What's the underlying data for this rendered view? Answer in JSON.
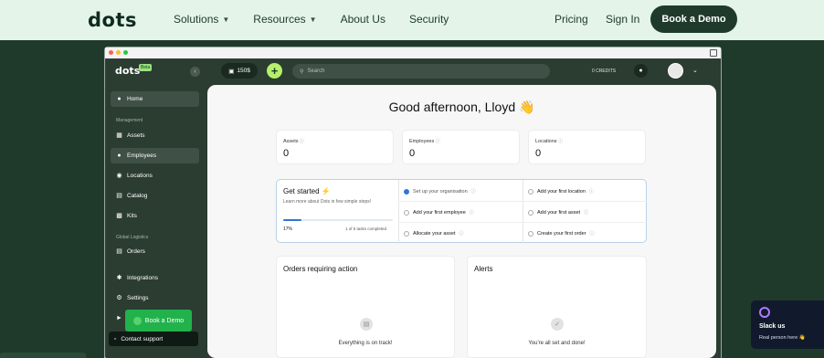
{
  "site": {
    "logo": "dots",
    "nav": [
      {
        "label": "Solutions",
        "has_dropdown": true
      },
      {
        "label": "Resources",
        "has_dropdown": true
      },
      {
        "label": "About Us",
        "has_dropdown": false
      },
      {
        "label": "Security",
        "has_dropdown": false
      }
    ],
    "pricing": "Pricing",
    "signin": "Sign In",
    "book_demo": "Book a Demo"
  },
  "app": {
    "logo": "dots",
    "beta": "Beta",
    "credit_amount": "150$",
    "search_placeholder": "Search",
    "credits_label": "0 CREDITS",
    "sidebar": {
      "home": "Home",
      "section_management": "Management",
      "items_management": [
        "Assets",
        "Employees",
        "Locations",
        "Catalog",
        "Kits"
      ],
      "section_logistics": "Global Logistics",
      "orders": "Orders",
      "integrations": "Integrations",
      "settings": "Settings",
      "contact_support": "Contact support"
    },
    "greeting": "Good afternoon, Lloyd 👋",
    "stats": [
      {
        "label": "Assets",
        "value": "0"
      },
      {
        "label": "Employees",
        "value": "0"
      },
      {
        "label": "Locations",
        "value": "0"
      }
    ],
    "get_started": {
      "title": "Get started",
      "subtitle": "Learn more about Dots in few simple steps!",
      "percent": "17%",
      "progress_fraction": 0.17,
      "completed": "1 of 6 tasks completed",
      "tasks_left": [
        "Set up your organisation",
        "Add your first employee",
        "Allocate your asset"
      ],
      "tasks_right": [
        "Add your first location",
        "Add your first asset",
        "Create your first order"
      ]
    },
    "orders_card": {
      "title": "Orders requiring action",
      "message": "Everything is on track!"
    },
    "alerts_card": {
      "title": "Alerts",
      "message": "You're all set and done!"
    },
    "book_demo_float": "Book a Demo"
  },
  "slack": {
    "title": "Slack us",
    "subtitle": "Real person here 👋"
  },
  "colors": {
    "brand_dark": "#1f3a2b",
    "accent_green": "#b6f06b",
    "progress_blue": "#2f77d6",
    "book_green": "#22b24c"
  }
}
